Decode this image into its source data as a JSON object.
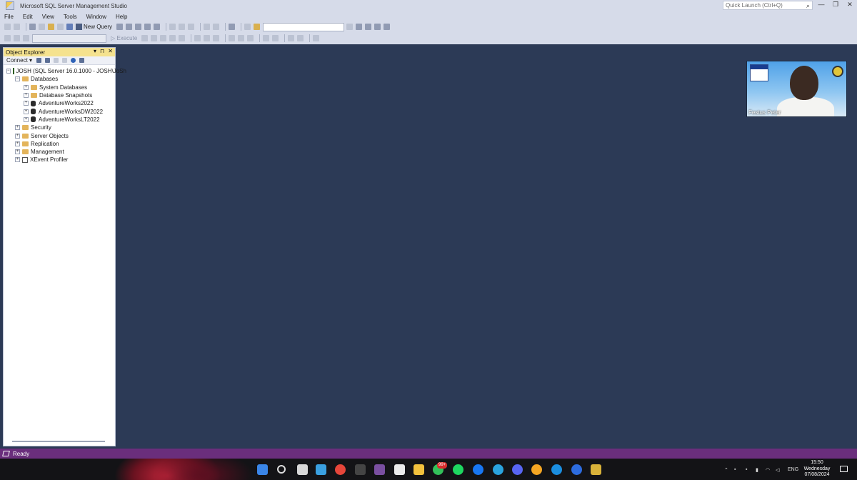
{
  "window": {
    "title": "Microsoft SQL Server Management Studio",
    "quick_launch_placeholder": "Quick Launch (Ctrl+Q)"
  },
  "menu": [
    "File",
    "Edit",
    "View",
    "Tools",
    "Window",
    "Help"
  ],
  "toolbar": {
    "new_query_label": "New Query",
    "execute_label": "Execute"
  },
  "object_explorer": {
    "title": "Object Explorer",
    "connect_label": "Connect",
    "tree": [
      {
        "label": "JOSH (SQL Server 16.0.1000 - JOSH\\JoSh",
        "level": 0,
        "icon": "server",
        "expander": "minus"
      },
      {
        "label": "Databases",
        "level": 1,
        "icon": "folder",
        "expander": "minus"
      },
      {
        "label": "System Databases",
        "level": 2,
        "icon": "folder",
        "expander": "plus"
      },
      {
        "label": "Database Snapshots",
        "level": 2,
        "icon": "folder",
        "expander": "plus"
      },
      {
        "label": "AdventureWorks2022",
        "level": 2,
        "icon": "database",
        "expander": "plus"
      },
      {
        "label": "AdventureWorksDW2022",
        "level": 2,
        "icon": "database",
        "expander": "plus"
      },
      {
        "label": "AdventureWorksLT2022",
        "level": 2,
        "icon": "database",
        "expander": "plus"
      },
      {
        "label": "Security",
        "level": 1,
        "icon": "folder",
        "expander": "plus"
      },
      {
        "label": "Server Objects",
        "level": 1,
        "icon": "folder",
        "expander": "plus"
      },
      {
        "label": "Replication",
        "level": 1,
        "icon": "folder",
        "expander": "plus"
      },
      {
        "label": "Management",
        "level": 1,
        "icon": "folder",
        "expander": "plus"
      },
      {
        "label": "XEvent Profiler",
        "level": 1,
        "icon": "profiler",
        "expander": "plus"
      }
    ]
  },
  "video_overlay": {
    "participant_name": "Festus Peter"
  },
  "status": {
    "text": "Ready"
  },
  "taskbar": {
    "badge": "99+",
    "tray": {
      "language": "ENG"
    },
    "clock": {
      "time": "15:50",
      "day": "Wednesday",
      "date": "07/08/2024"
    }
  },
  "colors": {
    "workspace": "#2c3a56",
    "status_bar": "#6a2e7c",
    "panel_header": "#f5e28e"
  }
}
